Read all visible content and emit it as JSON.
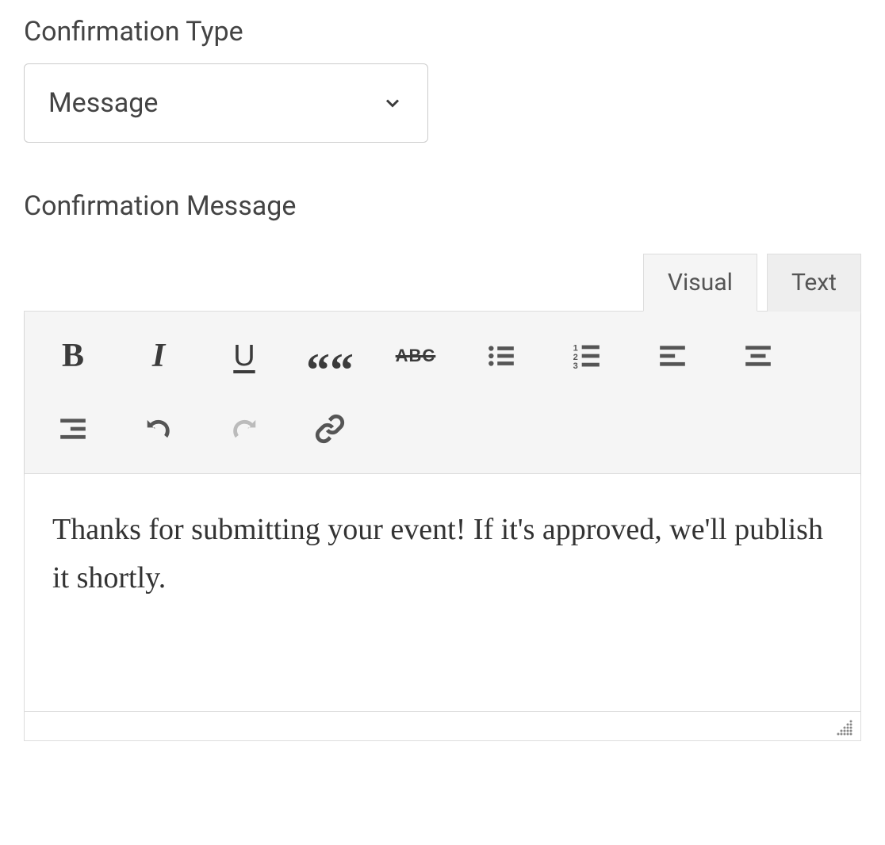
{
  "confirmation_type": {
    "label": "Confirmation Type",
    "value": "Message"
  },
  "confirmation_message": {
    "label": "Confirmation Message"
  },
  "editor": {
    "tabs": {
      "visual": "Visual",
      "text": "Text",
      "active": "visual"
    },
    "toolbar": {
      "bold": "B",
      "italic": "I",
      "underline": "U",
      "quote": "““",
      "strikethrough": "ABC"
    },
    "content": "Thanks for submitting your event! If it's approved, we'll publish it shortly."
  }
}
